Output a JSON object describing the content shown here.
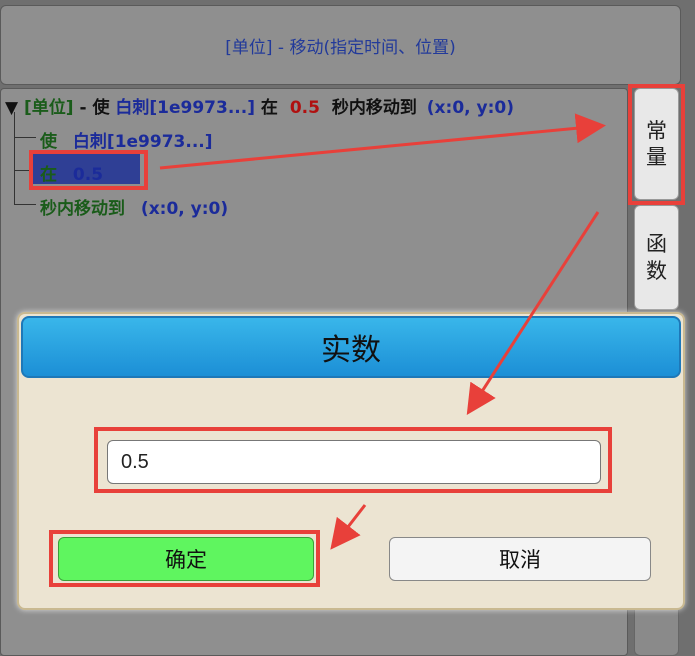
{
  "header": {
    "title": "[单位] - 移动(指定时间、位置)"
  },
  "tree": {
    "root": {
      "toggle": "▼",
      "unit": "[单位]",
      "dash_use": "- 使",
      "target": "白刺[1e9973...]",
      "at": "在",
      "time": "0.5",
      "move_to": "秒内移动到",
      "pos": "(x:0, y:0)"
    },
    "children": [
      {
        "label": "使",
        "value": "白刺[1e9973...]"
      },
      {
        "label": "在",
        "value": "0.5"
      },
      {
        "label": "秒内移动到",
        "value": "(x:0, y:0)"
      }
    ]
  },
  "side_tabs": {
    "constant": [
      "常",
      "量"
    ],
    "function": [
      "函",
      "数"
    ]
  },
  "dialog": {
    "title": "实数",
    "input_value": "0.5",
    "ok_label": "确定",
    "cancel_label": "取消"
  },
  "colors": {
    "highlight": "#e8403a",
    "ok_button": "#5ff55f",
    "dialog_title": "#1c8fd6"
  }
}
